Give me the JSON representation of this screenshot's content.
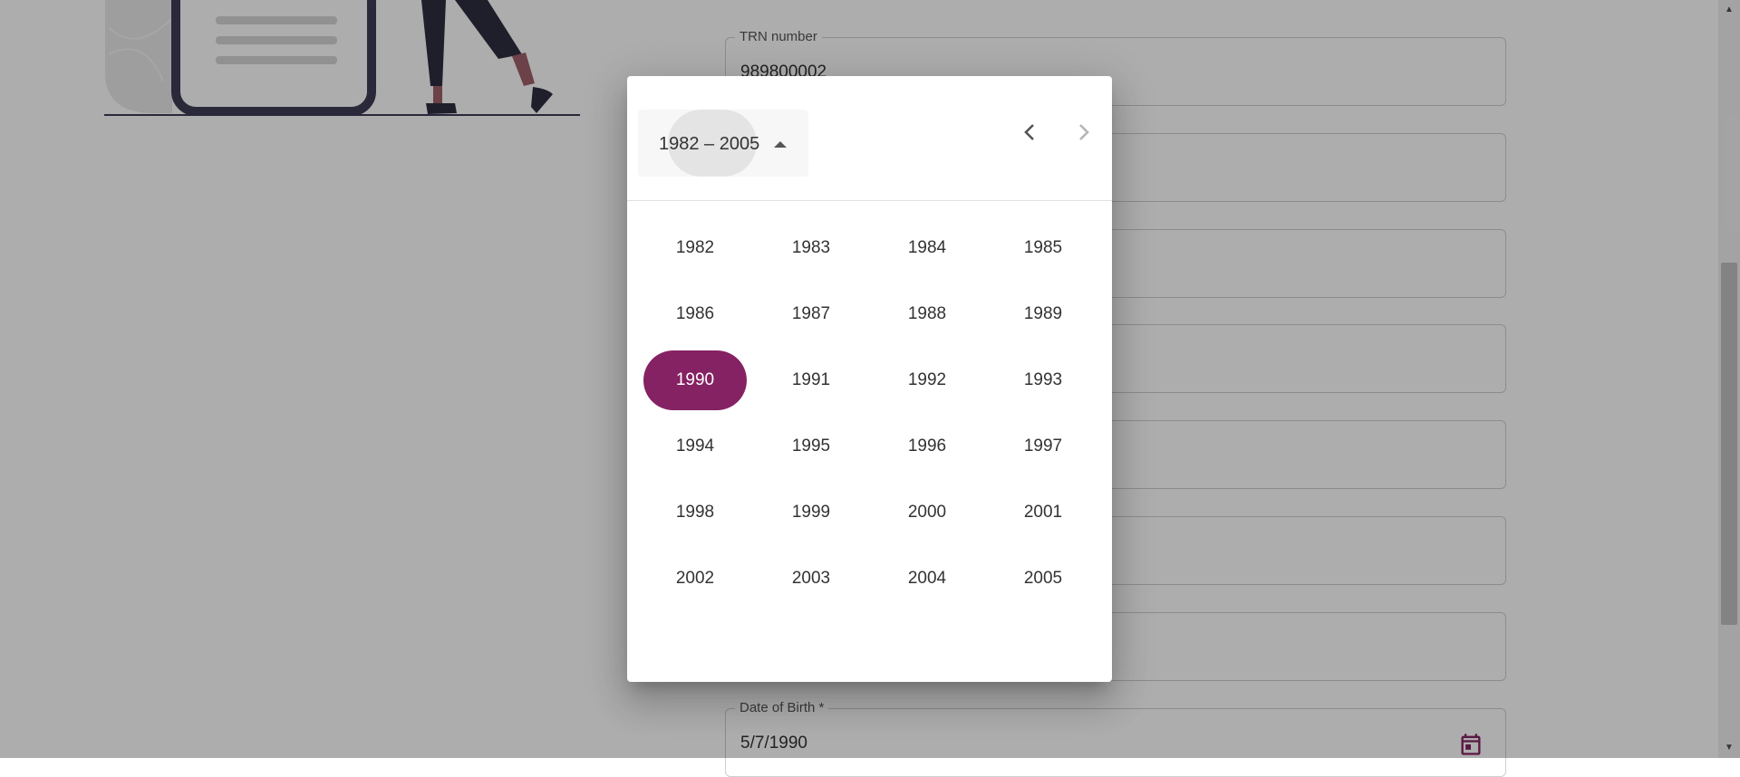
{
  "form": {
    "trn_label": "TRN number",
    "trn_value": "989800002",
    "dob_label": "Date of Birth *",
    "dob_value": "5/7/1990"
  },
  "colors": {
    "accent": "#852263",
    "backdrop": "rgba(0,0,0,0.32)"
  },
  "icons": {
    "prev": "chevron-left-icon",
    "next": "chevron-right-icon",
    "calendar": "calendar-icon",
    "period_toggle": "caret-up-icon"
  },
  "datepicker": {
    "period_label": "1982 – 2005",
    "selected_year": "1990",
    "years": [
      "1982",
      "1983",
      "1984",
      "1985",
      "1986",
      "1987",
      "1988",
      "1989",
      "1990",
      "1991",
      "1992",
      "1993",
      "1994",
      "1995",
      "1996",
      "1997",
      "1998",
      "1999",
      "2000",
      "2001",
      "2002",
      "2003",
      "2004",
      "2005"
    ]
  }
}
